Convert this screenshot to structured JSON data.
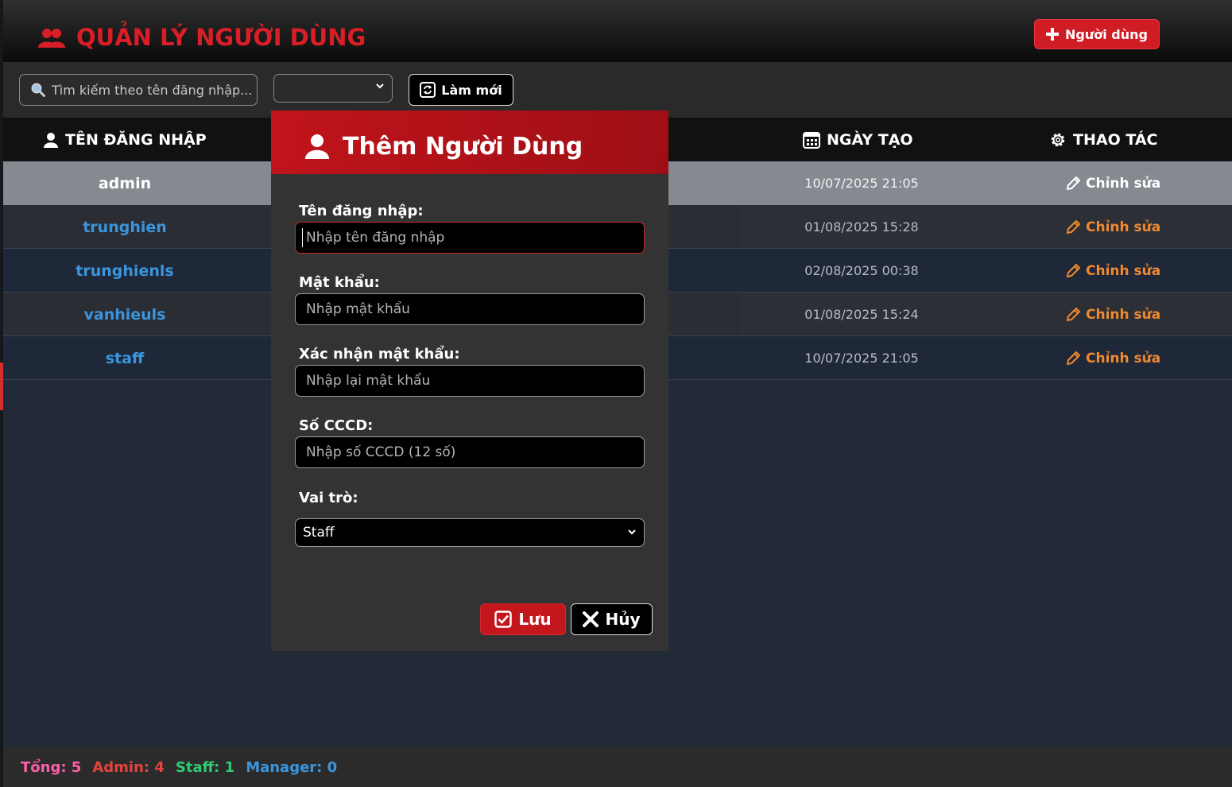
{
  "header": {
    "title": "QUẢN LÝ NGƯỜI DÙNG",
    "add_user_label": "Người dùng"
  },
  "toolbar": {
    "search_placeholder": "Tìm kiếm theo tên đăng nhập...",
    "role_filter_value": "",
    "refresh_label": "Làm mới"
  },
  "table": {
    "columns": {
      "username": "TÊN ĐĂNG NHẬP",
      "created": "NGÀY TẠO",
      "actions": "THAO TÁC"
    },
    "action_label": "Chỉnh sửa",
    "rows": [
      {
        "username": "admin",
        "created": "10/07/2025 21:05"
      },
      {
        "username": "trunghien",
        "created": "01/08/2025 15:28"
      },
      {
        "username": "trunghienls",
        "created": "02/08/2025 00:38"
      },
      {
        "username": "vanhieuls",
        "created": "01/08/2025 15:24"
      },
      {
        "username": "staff",
        "created": "10/07/2025 21:05"
      }
    ]
  },
  "footer": {
    "total": "Tổng: 5",
    "admin": "Admin: 4",
    "staff": "Staff: 1",
    "manager": "Manager: 0"
  },
  "modal": {
    "title": "Thêm Người Dùng",
    "username_label": "Tên đăng nhập:",
    "username_placeholder": "Nhập tên đăng nhập",
    "password_label": "Mật khẩu:",
    "password_placeholder": "Nhập mật khẩu",
    "confirm_label": "Xác nhận mật khẩu:",
    "confirm_placeholder": "Nhập lại mật khẩu",
    "cccd_label": "Số CCCD:",
    "cccd_placeholder": "Nhập số CCCD (12 số)",
    "role_label": "Vai trò:",
    "role_value": "Staff",
    "save_label": "Lưu",
    "cancel_label": "Hủy"
  },
  "colors": {
    "accent_red": "#d81e27",
    "username_blue": "#3b95dd",
    "action_orange": "#f0892f",
    "total_pink": "#ff5fa8",
    "admin_red": "#e5453d",
    "staff_green": "#2ecc71",
    "manager_blue": "#3b95dd"
  }
}
